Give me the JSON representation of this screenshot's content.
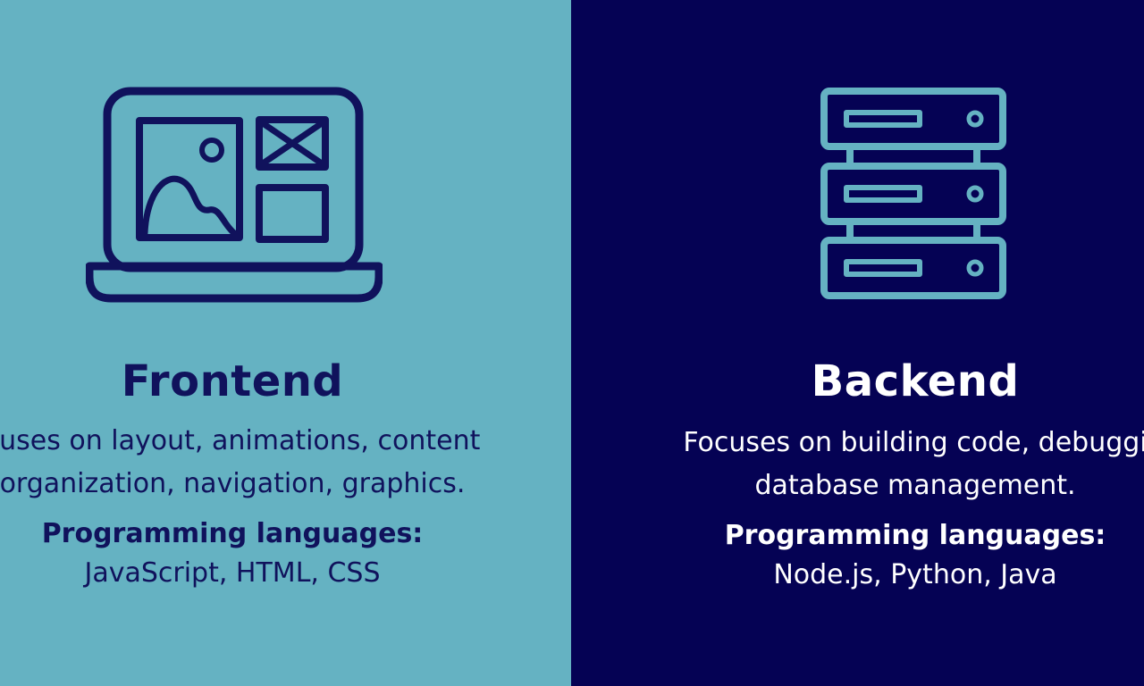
{
  "colors": {
    "frontend_background": "#65b2c2",
    "frontend_foreground": "#10125c",
    "backend_background": "#050254",
    "backend_foreground": "#ffffff",
    "server_icon_stroke": "#65b2c2"
  },
  "frontend": {
    "icon": "laptop-wireframe-icon",
    "title": "Frontend",
    "description": "cuses on layout, animations, content\norganization, navigation, graphics.",
    "languages_label": "Programming languages:",
    "languages": "JavaScript, HTML, CSS"
  },
  "backend": {
    "icon": "server-stack-icon",
    "title": "Backend",
    "description": "Focuses on building code, debuggi\ndatabase management.",
    "languages_label": "Programming languages:",
    "languages": "Node.js, Python, Java"
  }
}
